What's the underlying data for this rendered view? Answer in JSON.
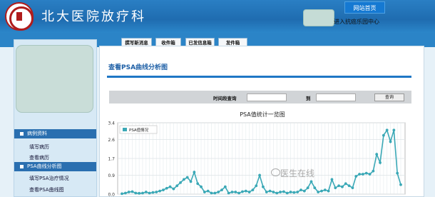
{
  "header": {
    "site_title": "北大医院放疗科",
    "home_button": "网站首页",
    "external_link": "进入抗癌乐园中心"
  },
  "tabs": [
    {
      "label": "撰写新消息"
    },
    {
      "label": "收件箱"
    },
    {
      "label": "已发信息箱"
    },
    {
      "label": "发件箱"
    }
  ],
  "sidebar": {
    "sections": [
      {
        "title": "病例资料",
        "items": [
          "填写病历",
          "查看病历"
        ]
      },
      {
        "title": "PSA曲线分析图",
        "items": [
          "填写PSA治疗情况",
          "查看PSA曲线图"
        ]
      }
    ]
  },
  "main": {
    "page_title": "查看PSA曲线分析图",
    "filter": {
      "label": "时间段查询",
      "to_label": "到",
      "query_button": "查询"
    }
  },
  "chart_data": {
    "type": "line",
    "title": "PSA值统计一览图",
    "series": [
      {
        "name": "PSA值情况",
        "color": "#3aa8b6",
        "values": [
          0.02,
          0.05,
          0.1,
          0.12,
          0.05,
          0.04,
          0.05,
          0.1,
          0.05,
          0.08,
          0.1,
          0.15,
          0.2,
          0.28,
          0.35,
          0.25,
          0.4,
          0.55,
          0.7,
          0.8,
          0.6,
          1.05,
          0.5,
          0.35,
          0.1,
          0.15,
          0.05,
          0.05,
          0.1,
          0.2,
          0.35,
          0.05,
          0.1,
          0.1,
          0.05,
          0.12,
          0.15,
          0.1,
          0.2,
          0.4,
          0.9,
          0.35,
          0.1,
          0.15,
          0.1,
          0.05,
          0.1,
          0.12,
          0.05,
          0.1,
          0.08,
          0.1,
          0.2,
          0.15,
          0.3,
          0.6,
          0.3,
          0.1,
          0.15,
          0.2,
          0.15,
          0.7,
          0.3,
          0.4,
          0.35,
          0.5,
          0.4,
          0.3,
          0.85,
          0.95,
          0.95,
          1.0,
          0.95,
          1.1,
          1.9,
          1.5,
          2.8,
          3.05,
          2.5,
          3.05,
          1.0,
          0.45
        ]
      }
    ],
    "yticks": [
      "3.4",
      "2.6",
      "1.7",
      "0.9",
      "0.0"
    ],
    "ylim": [
      0,
      3.4
    ],
    "grid": true,
    "legend_position": "top-left"
  },
  "watermark": "医生在线"
}
